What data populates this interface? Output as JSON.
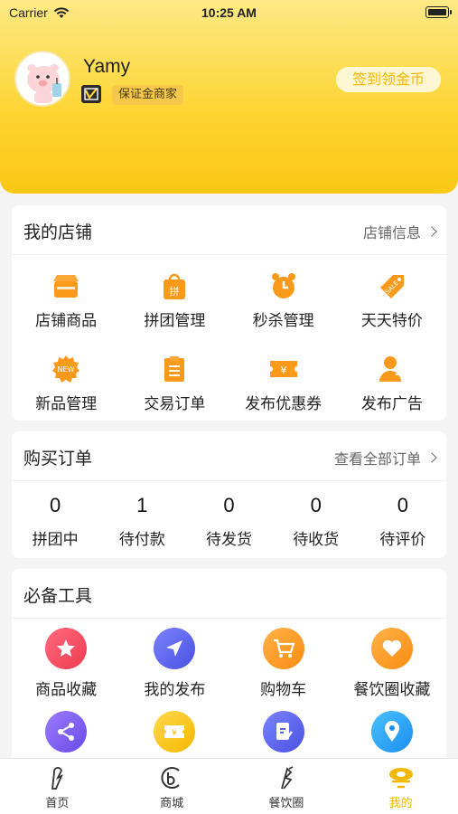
{
  "status_bar": {
    "carrier": "Carrier",
    "time": "10:25 AM"
  },
  "profile": {
    "name": "Yamy",
    "badge": "保证金商家",
    "signin_button": "签到领金币"
  },
  "shop": {
    "title": "我的店铺",
    "link": "店铺信息",
    "items": [
      {
        "label": "店铺商品",
        "icon": "store-icon"
      },
      {
        "label": "拼团管理",
        "icon": "group-buy-bag-icon"
      },
      {
        "label": "秒杀管理",
        "icon": "alarm-clock-icon"
      },
      {
        "label": "天天特价",
        "icon": "sale-tag-icon"
      },
      {
        "label": "新品管理",
        "icon": "new-badge-icon"
      },
      {
        "label": "交易订单",
        "icon": "order-list-icon"
      },
      {
        "label": "发布优惠券",
        "icon": "coupon-icon"
      },
      {
        "label": "发布广告",
        "icon": "ad-user-icon"
      }
    ]
  },
  "orders": {
    "title": "购买订单",
    "link": "查看全部订单",
    "items": [
      {
        "count": "0",
        "label": "拼团中"
      },
      {
        "count": "1",
        "label": "待付款"
      },
      {
        "count": "0",
        "label": "待发货"
      },
      {
        "count": "0",
        "label": "待收货"
      },
      {
        "count": "0",
        "label": "待评价"
      }
    ]
  },
  "tools": {
    "title": "必备工具",
    "items": [
      {
        "label": "商品收藏",
        "icon": "star-icon",
        "color": "#f5425a"
      },
      {
        "label": "我的发布",
        "icon": "send-icon",
        "color": "#5b63f0"
      },
      {
        "label": "购物车",
        "icon": "cart-icon",
        "color": "#fb9a1a"
      },
      {
        "label": "餐饮圈收藏",
        "icon": "heart-icon",
        "color": "#fb9a1a"
      },
      {
        "label": "",
        "icon": "share-icon",
        "color": "#7a5cf0"
      },
      {
        "label": "",
        "icon": "ticket-icon",
        "color": "#f7c21c"
      },
      {
        "label": "",
        "icon": "edit-icon",
        "color": "#5b63f0"
      },
      {
        "label": "",
        "icon": "location-icon",
        "color": "#1fa5f5"
      }
    ]
  },
  "tabs": [
    {
      "label": "首页",
      "icon": "home-icon"
    },
    {
      "label": "商城",
      "icon": "mall-icon"
    },
    {
      "label": "餐饮圈",
      "icon": "dining-circle-icon"
    },
    {
      "label": "我的",
      "icon": "profile-icon",
      "active": true
    }
  ],
  "colors": {
    "accent": "#fdd430",
    "active_tab": "#f5b800"
  }
}
